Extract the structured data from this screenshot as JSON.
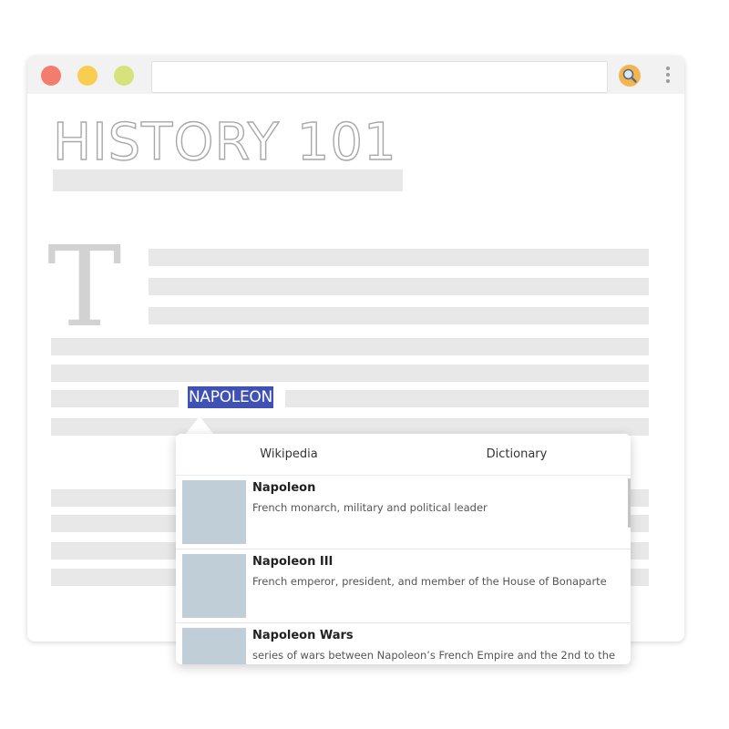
{
  "window": {
    "buttons": {
      "close_color": "#f47c6c",
      "minimize_color": "#f9cd51",
      "maximize_color": "#d6e27b"
    },
    "address_bar": {
      "value": ""
    },
    "search_button_color": "#f2b552",
    "menu_icon": "kebab-menu-icon"
  },
  "page": {
    "title": "HISTORY 101",
    "drop_cap": "T",
    "selected_word": "NAPOLEON",
    "selection_color": "#3f51b5"
  },
  "popup": {
    "tabs": [
      {
        "label": "Wikipedia"
      },
      {
        "label": "Dictionary"
      }
    ],
    "results": [
      {
        "title": "Napoleon",
        "description": "French monarch, military and political leader"
      },
      {
        "title": "Napoleon III",
        "description": "French emperor, president, and member of the House of Bonaparte"
      },
      {
        "title": "Napoleon Wars",
        "description": "series of wars between Napoleon’s French Empire and the 2nd to the"
      }
    ]
  }
}
